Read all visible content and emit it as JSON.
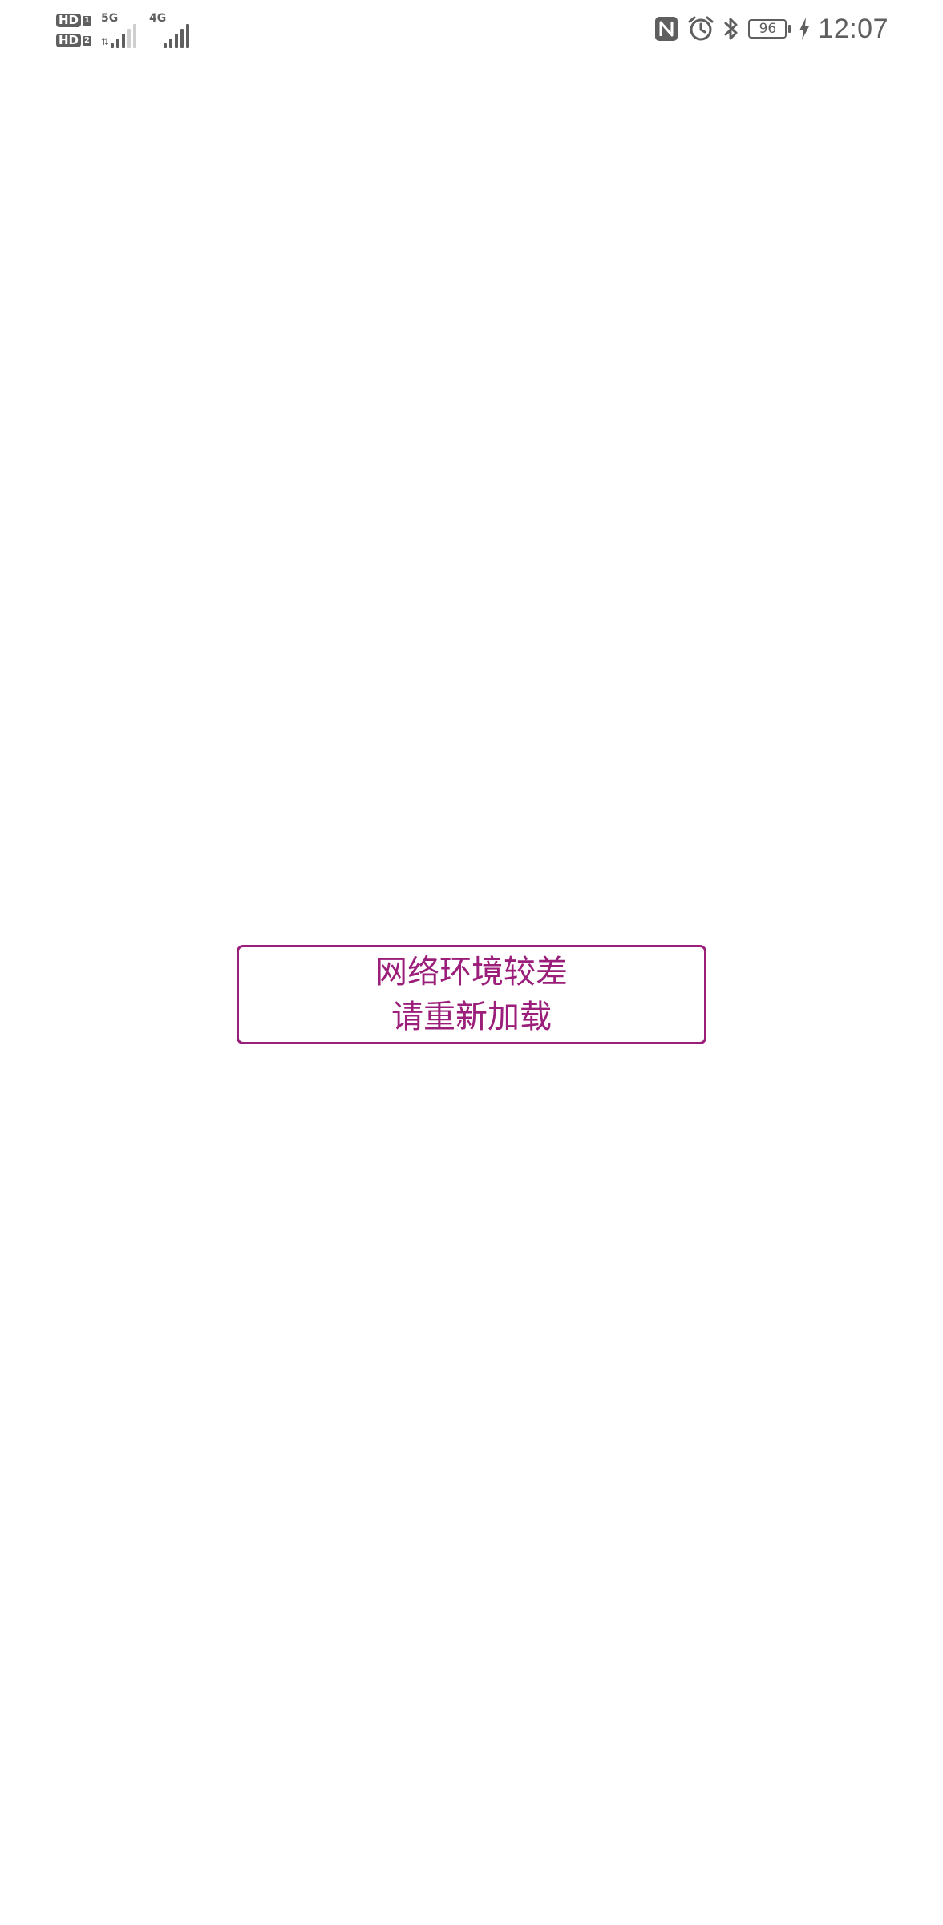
{
  "status_bar": {
    "hd_label": "HD",
    "sim1": "1",
    "sim2": "2",
    "network1": "5G",
    "network2": "4G",
    "icons": [
      "nfc-icon",
      "alarm-icon",
      "bluetooth-icon",
      "battery-icon",
      "charging-icon"
    ],
    "battery_level": "96",
    "time": "12:07",
    "color": "#5f5f5f"
  },
  "reload": {
    "line1": "网络环境较差",
    "line2": "请重新加载",
    "accent_color": "#9b1f7a"
  }
}
